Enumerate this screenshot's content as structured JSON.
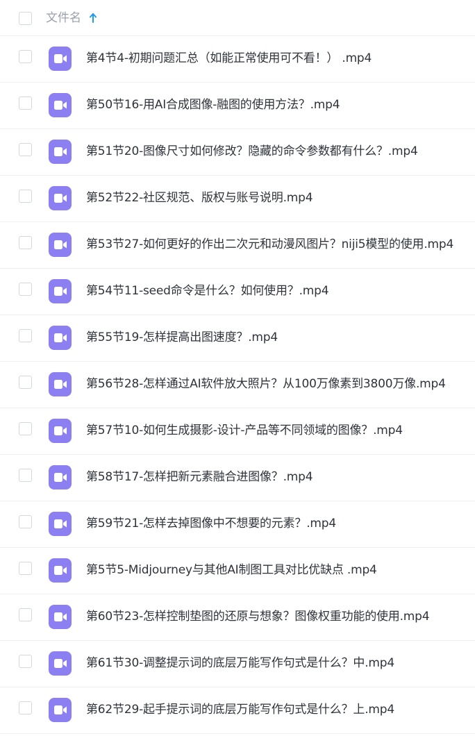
{
  "header": {
    "name_column_label": "文件名",
    "sort_icon": "arrow-up-icon",
    "sort_color": "#1a9cf0"
  },
  "file_icon_color": "#8b7ff2",
  "files": [
    {
      "name": "第4节4-初期问题汇总（如能正常使用可不看！） .mp4",
      "icon": "video-file-icon"
    },
    {
      "name": "第50节16-用AI合成图像-融图的使用方法？.mp4",
      "icon": "video-file-icon"
    },
    {
      "name": "第51节20-图像尺寸如何修改？隐藏的命令参数都有什么？.mp4",
      "icon": "video-file-icon"
    },
    {
      "name": "第52节22-社区规范、版权与账号说明.mp4",
      "icon": "video-file-icon"
    },
    {
      "name": "第53节27-如何更好的作出二次元和动漫风图片？niji5模型的使用.mp4",
      "icon": "video-file-icon"
    },
    {
      "name": "第54节11-seed命令是什么？如何使用？.mp4",
      "icon": "video-file-icon"
    },
    {
      "name": "第55节19-怎样提高出图速度？.mp4",
      "icon": "video-file-icon"
    },
    {
      "name": "第56节28-怎样通过AI软件放大照片？从100万像素到3800万像.mp4",
      "icon": "video-file-icon"
    },
    {
      "name": "第57节10-如何生成摄影-设计-产品等不同领域的图像？.mp4",
      "icon": "video-file-icon"
    },
    {
      "name": "第58节17-怎样把新元素融合进图像？.mp4",
      "icon": "video-file-icon"
    },
    {
      "name": "第59节21-怎样去掉图像中不想要的元素？.mp4",
      "icon": "video-file-icon"
    },
    {
      "name": "第5节5-Midjourney与其他AI制图工具对比优缺点 .mp4",
      "icon": "video-file-icon"
    },
    {
      "name": "第60节23-怎样控制垫图的还原与想象？图像权重功能的使用.mp4",
      "icon": "video-file-icon"
    },
    {
      "name": "第61节30-调整提示词的底层万能写作句式是什么？中.mp4",
      "icon": "video-file-icon"
    },
    {
      "name": "第62节29-起手提示词的底层万能写作句式是什么？上.mp4",
      "icon": "video-file-icon"
    }
  ]
}
